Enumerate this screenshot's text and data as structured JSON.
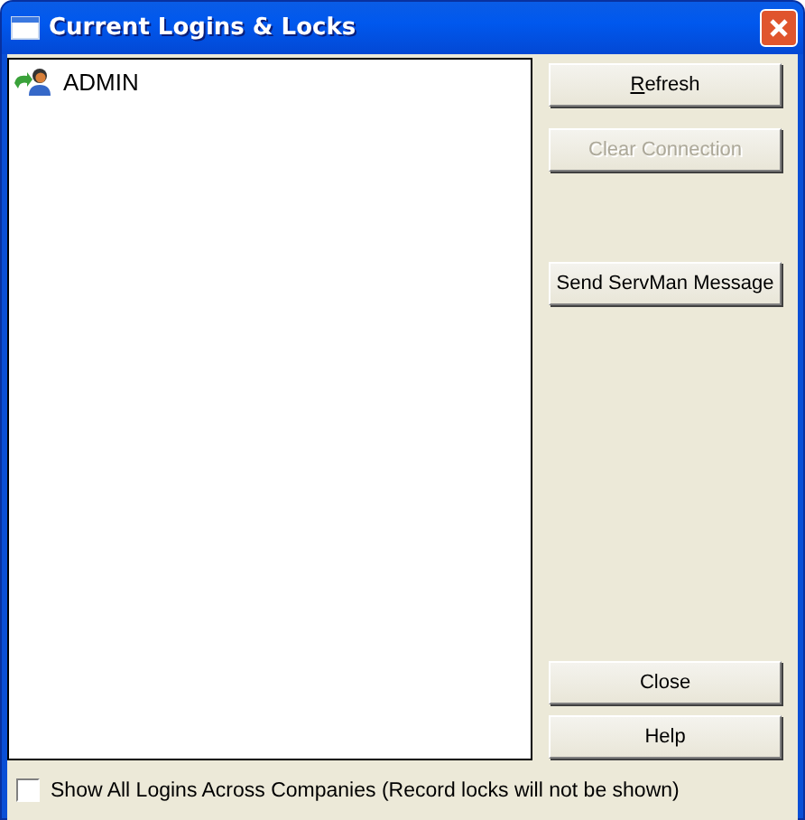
{
  "window": {
    "title": "Current Logins & Locks"
  },
  "logins": [
    {
      "name": "ADMIN",
      "selected": false
    }
  ],
  "buttons_top": [
    {
      "mnemonic": "R",
      "label": "efresh",
      "disabled": false
    },
    {
      "label": "Clear Connection",
      "disabled": true
    },
    {
      "label": "Send ServMan Message",
      "disabled": false
    }
  ],
  "buttons_bottom": [
    {
      "label": "Close",
      "disabled": false
    },
    {
      "label": "Help",
      "disabled": false
    }
  ],
  "show_all": {
    "label": "Show All Logins Across Companies (Record locks will not be shown)",
    "checked": false
  }
}
